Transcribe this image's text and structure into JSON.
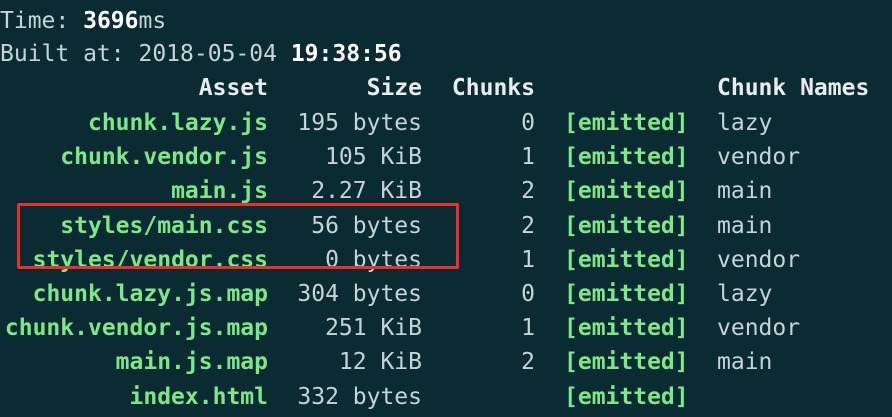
{
  "time": {
    "label": "Time: ",
    "value": "3696",
    "unit": "ms"
  },
  "built": {
    "label": "Built at: ",
    "date": "2018-05-04",
    "time": "19:38:56"
  },
  "headers": {
    "asset": "Asset",
    "size": "Size",
    "chunks": "Chunks",
    "chunk_names": "Chunk Names"
  },
  "rows": [
    {
      "asset": "chunk.lazy.js",
      "size": "195 bytes",
      "chunks": "0",
      "status": "[emitted]",
      "name": "lazy"
    },
    {
      "asset": "chunk.vendor.js",
      "size": "105 KiB",
      "chunks": "1",
      "status": "[emitted]",
      "name": "vendor"
    },
    {
      "asset": "main.js",
      "size": "2.27 KiB",
      "chunks": "2",
      "status": "[emitted]",
      "name": "main"
    },
    {
      "asset": "styles/main.css",
      "size": "56 bytes",
      "chunks": "2",
      "status": "[emitted]",
      "name": "main"
    },
    {
      "asset": "styles/vendor.css",
      "size": "0 bytes",
      "chunks": "1",
      "status": "[emitted]",
      "name": "vendor"
    },
    {
      "asset": "chunk.lazy.js.map",
      "size": "304 bytes",
      "chunks": "0",
      "status": "[emitted]",
      "name": "lazy"
    },
    {
      "asset": "chunk.vendor.js.map",
      "size": "251 KiB",
      "chunks": "1",
      "status": "[emitted]",
      "name": "vendor"
    },
    {
      "asset": "main.js.map",
      "size": "12 KiB",
      "chunks": "2",
      "status": "[emitted]",
      "name": "main"
    },
    {
      "asset": "index.html",
      "size": "332 bytes",
      "chunks": "",
      "status": "[emitted]",
      "name": ""
    }
  ],
  "colors": {
    "background": "#0b2b33",
    "text": "#c7d3d6",
    "asset_green": "#7ee787",
    "highlight_red": "#e8302d"
  }
}
